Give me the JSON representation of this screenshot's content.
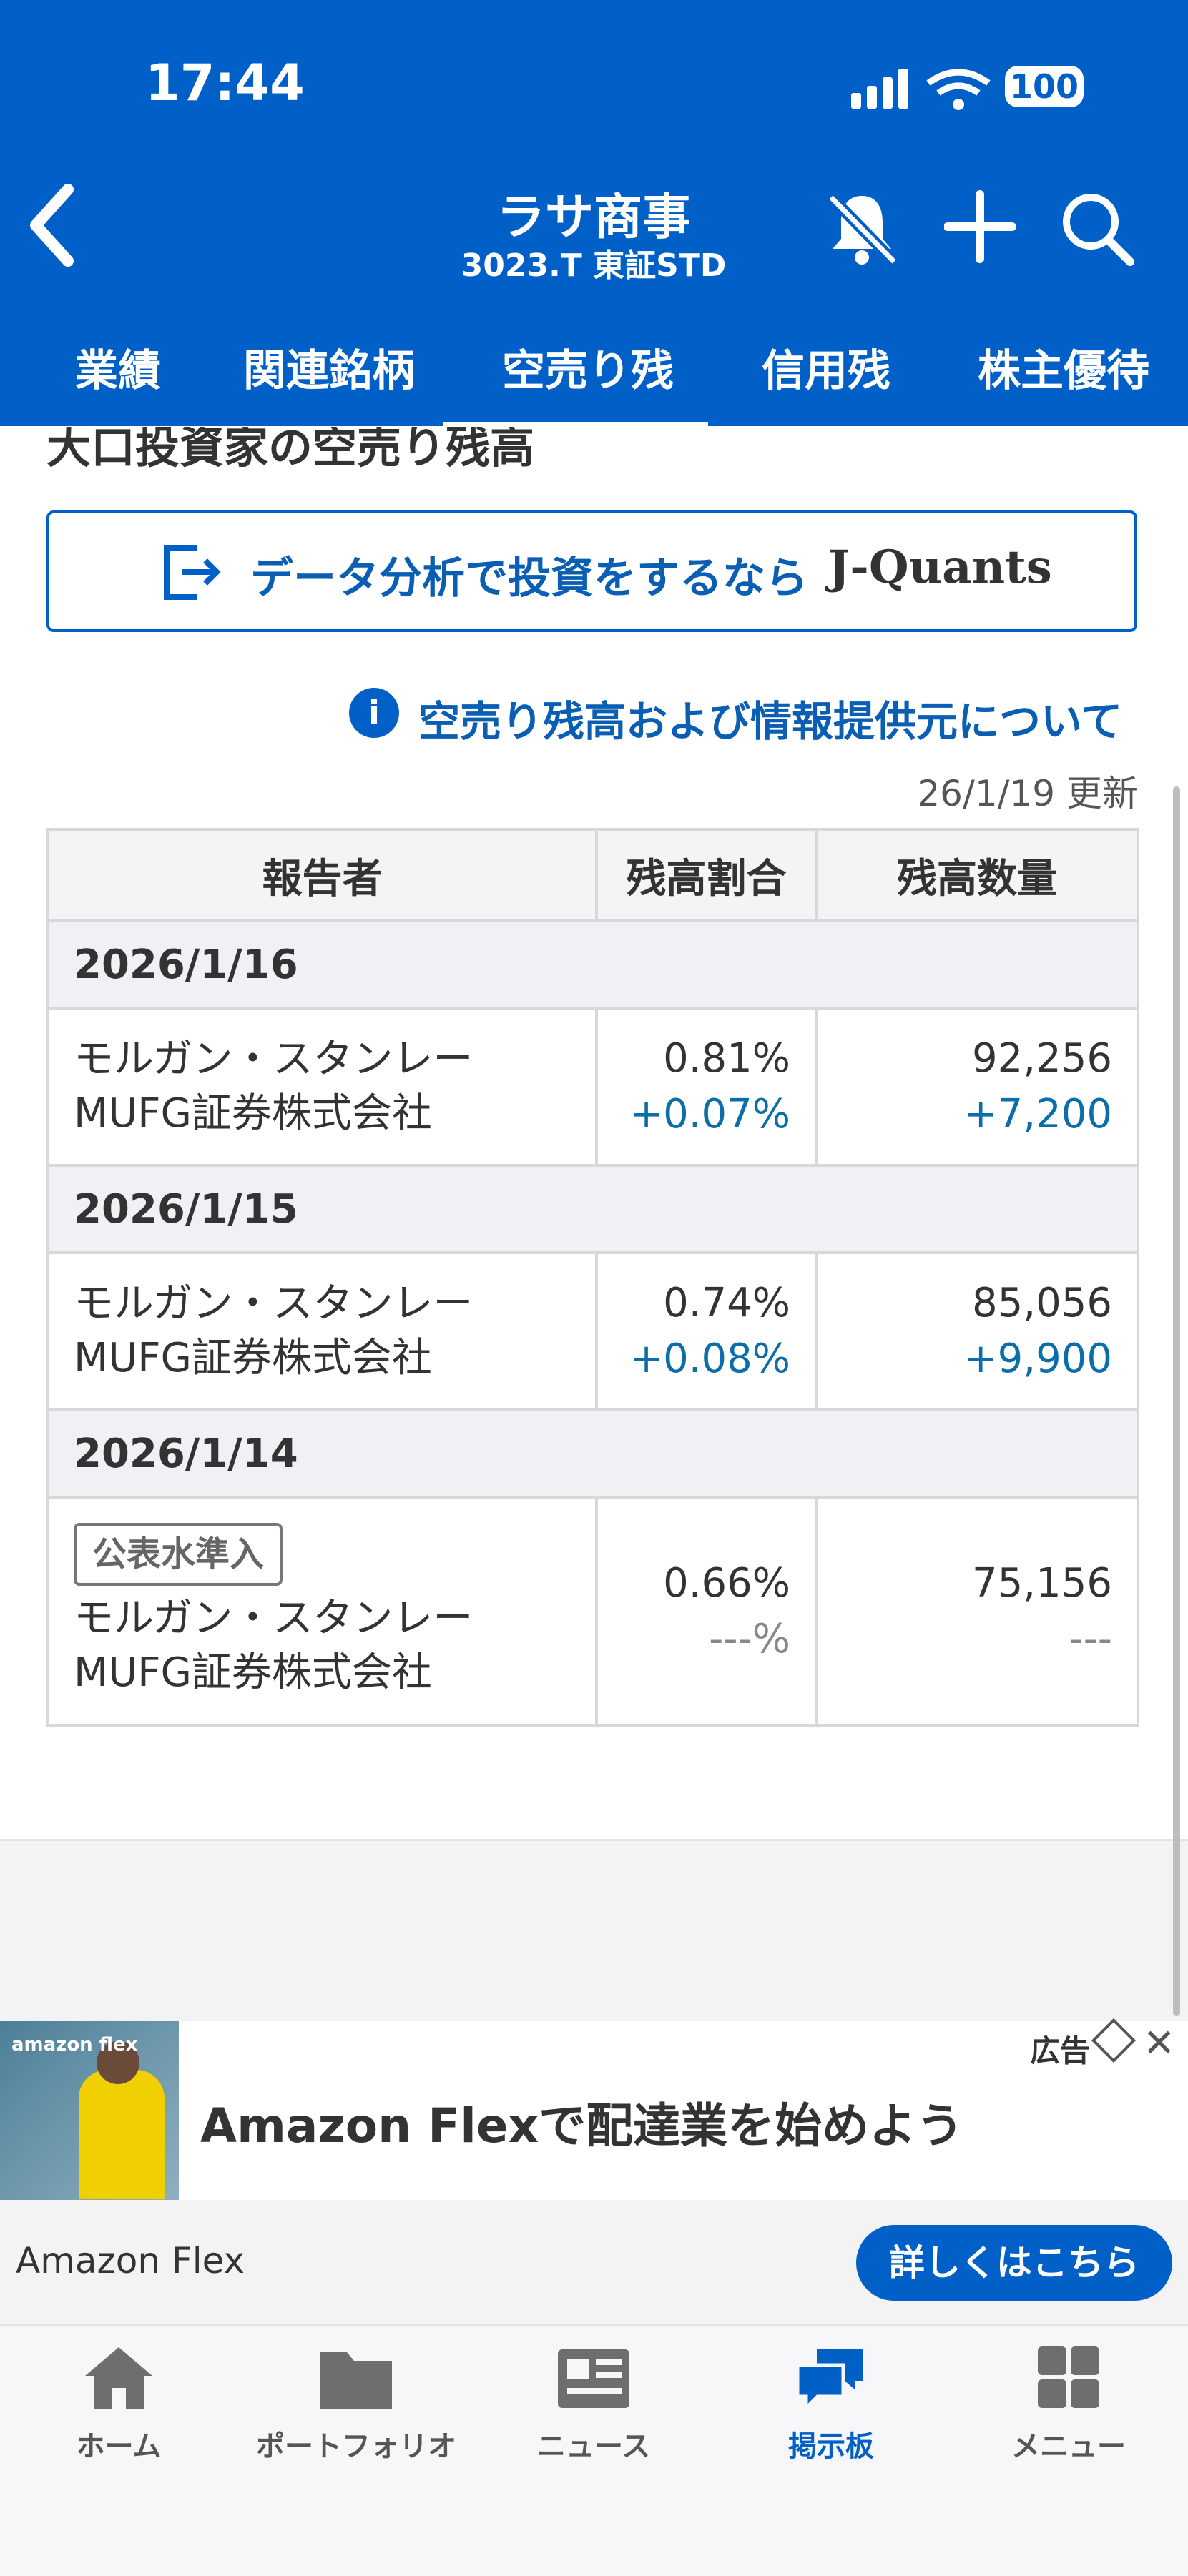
{
  "status": {
    "time": "17:44",
    "battery": "100"
  },
  "header": {
    "title": "ラサ商事",
    "subtitle": "3023.T 東証STD"
  },
  "tabs": [
    "業績",
    "関連銘柄",
    "空売り残",
    "信用残",
    "株主優待"
  ],
  "active_tab": "空売り残",
  "content": {
    "section_title": "大口投資家の空売り残高",
    "banner_text": "データ分析で投資をするなら",
    "banner_logo": "J-Quants",
    "info_link": "空売り残高および情報提供元について",
    "updated": "26/1/19 更新",
    "table_headers": [
      "報告者",
      "残高割合",
      "残高数量"
    ],
    "groups": [
      {
        "date": "2026/1/16",
        "badge": "",
        "reporter_line1": "モルガン・スタンレー",
        "reporter_line2": "MUFG証券株式会社",
        "ratio": "0.81%",
        "ratio_change": "+0.07%",
        "qty": "92,256",
        "qty_change": "+7,200"
      },
      {
        "date": "2026/1/15",
        "badge": "",
        "reporter_line1": "モルガン・スタンレー",
        "reporter_line2": "MUFG証券株式会社",
        "ratio": "0.74%",
        "ratio_change": "+0.08%",
        "qty": "85,056",
        "qty_change": "+9,900"
      },
      {
        "date": "2026/1/14",
        "badge": "公表水準入",
        "reporter_line1": "モルガン・スタンレー",
        "reporter_line2": "MUFG証券株式会社",
        "ratio": "0.66%",
        "ratio_change": "---%",
        "qty": "75,156",
        "qty_change": "---"
      }
    ]
  },
  "ad": {
    "label": "広告",
    "image_text": "amazon flex",
    "title": "Amazon Flexで配達業を始めよう",
    "advertiser": "Amazon Flex",
    "cta": "詳しくはこちら"
  },
  "nav": {
    "items": [
      {
        "label": "ホーム",
        "icon": "home-icon"
      },
      {
        "label": "ポートフォリオ",
        "icon": "folder-icon"
      },
      {
        "label": "ニュース",
        "icon": "newspaper-icon"
      },
      {
        "label": "掲示板",
        "icon": "chat-icon"
      },
      {
        "label": "メニュー",
        "icon": "grid-icon"
      }
    ],
    "active": "掲示板"
  },
  "colors": {
    "brand": "#0060c8",
    "positive": "#0a6fa8"
  }
}
